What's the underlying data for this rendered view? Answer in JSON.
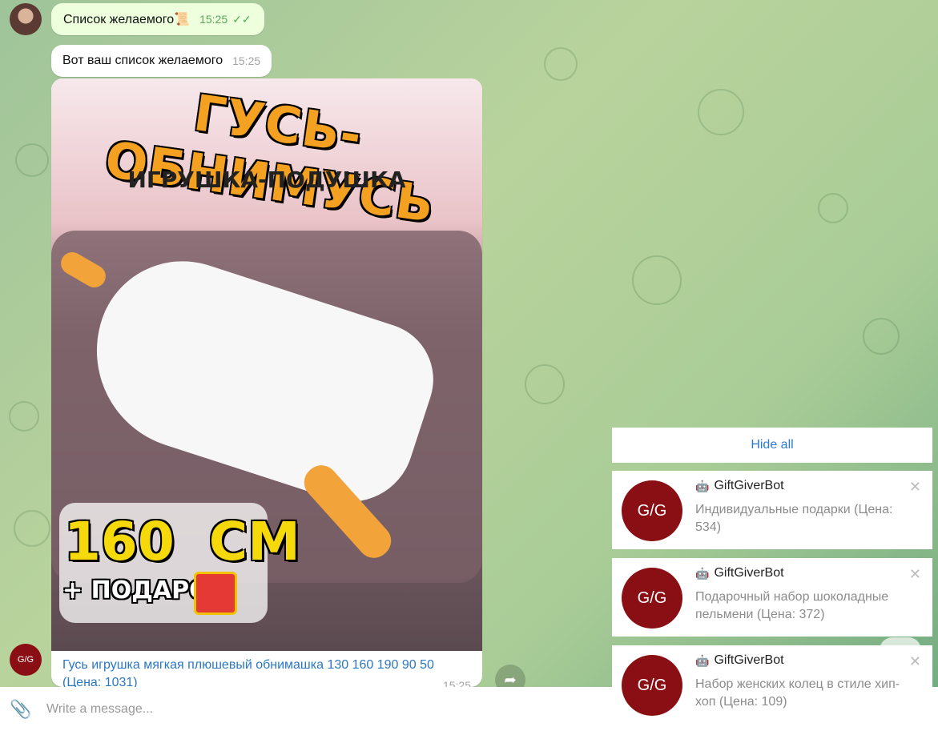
{
  "chat": {
    "message1": {
      "text": "Список желаемого📜",
      "time": "15:25",
      "status": "✓✓"
    },
    "message2": {
      "text": "Вот ваш список желаемого",
      "time": "15:25"
    },
    "product": {
      "image_title": "ГУСЬ-ОБНИМУСЬ",
      "image_subtitle": "ИГРУШКА-ПОДУШКА",
      "image_size": "160 СМ",
      "image_gift": "+ ПОДАРОК",
      "caption": "Гусь игрушка мягкая плюшевый обнимашка 130 160 190 90 50 (Цена: 1031)",
      "time": "15:25"
    },
    "bot_avatar_text": "G/G"
  },
  "composer": {
    "placeholder": "Write a message..."
  },
  "notifications": {
    "hide_all": "Hide all",
    "items": [
      {
        "title": "GiftGiverBot",
        "text": "Индивидуальные подарки (Цена: 534)",
        "avatar": "G/G"
      },
      {
        "title": "GiftGiverBot",
        "text": "Подарочный набор шоколадные пельмени (Цена: 372)",
        "avatar": "G/G"
      },
      {
        "title": "GiftGiverBot",
        "text": "Набор женских колец в стиле хип-хоп (Цена: 109)",
        "avatar": "G/G"
      }
    ]
  }
}
